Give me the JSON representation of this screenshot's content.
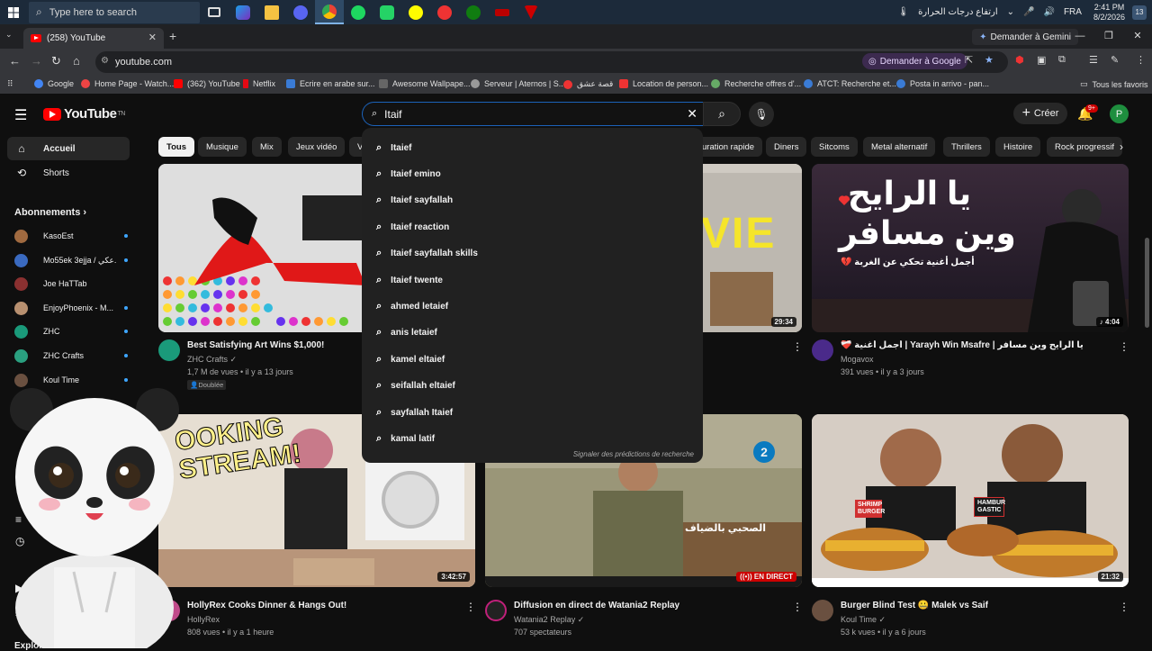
{
  "taskbar": {
    "search_placeholder": "Type here to search",
    "weather_text": "ارتفاع درجات الحرارة",
    "language": "FRA",
    "time": "2:41 PM",
    "date": "8/2/2026",
    "notifications": "13"
  },
  "browser": {
    "tab_title": "(258) YouTube",
    "gemini_label": "Demander à Gemini",
    "url": "youtube.com",
    "ask_google": "Demander à Google",
    "bookmarks": [
      "Google",
      "Home Page - Watch...",
      "(362) YouTube",
      "Netflix",
      "Ecrire en arabe sur...",
      "Awesome Wallpape...",
      "Serveur | Aternos | S...",
      "قصة عشق",
      "Location de person...",
      "Recherche offres d'...",
      "ATCT: Recherche et...",
      "Posta in arrivo - pan..."
    ],
    "all_bookmarks": "Tous les favoris",
    "colors": {
      "bookmark_icons": [
        "#4285f4",
        "#e44",
        "#ff0000",
        "#e50914",
        "#3a7bd5",
        "#666",
        "#999",
        "#e33",
        "#e33",
        "#6a6",
        "#3a7bd5",
        "#3a7bd5"
      ]
    }
  },
  "youtube": {
    "logo": "YouTube",
    "logo_tm": "TN",
    "search_value": "Itaif",
    "create_label": "Créer",
    "bell_badge": "9+",
    "avatar_letter": "P",
    "sidebar": {
      "items": [
        {
          "label": "Accueil",
          "icon": "home-icon"
        },
        {
          "label": "Shorts",
          "icon": "shorts-icon"
        }
      ],
      "subscriptions_title": "Abonnements",
      "subscriptions": [
        {
          "name": "KasoEst",
          "color": "#a06a40"
        },
        {
          "name": "Mo55ek 3ejja / عكي...",
          "color": "#3a6ac0"
        },
        {
          "name": "Joe HaTTab",
          "color": "#8a3030"
        },
        {
          "name": "EnjoyPhoenix - M...",
          "color": "#b89070"
        },
        {
          "name": "ZHC",
          "color": "#1a9a7a"
        },
        {
          "name": "ZHC Crafts",
          "color": "#2aa080"
        },
        {
          "name": "Koul Time",
          "color": "#6a5040"
        }
      ],
      "explorer": "Explorer"
    },
    "chips": [
      "Tous",
      "Musique",
      "Mix",
      "Jeux vidéo",
      "V",
      "uration rapide",
      "Diners",
      "Sitcoms",
      "Metal alternatif",
      "Thrillers",
      "Histoire",
      "Rock progressif"
    ],
    "suggestions": [
      "Itaief",
      "Itaief emino",
      "Itaief sayfallah",
      "Itaief reaction",
      "Itaief sayfallah skills",
      "Itaief twente",
      "ahmed letaief",
      "anis letaief",
      "kamel eltaief",
      "seifallah eltaief",
      "sayfallah Itaief",
      "kamal latif"
    ],
    "report_predictions": "Signaler des prédictions de recherche",
    "videos": [
      {
        "title": "Best Satisfying Art Wins $1,000!",
        "channel": "ZHC Crafts",
        "meta": "1,7 M de vues • il y a 13 jours",
        "badge": "Doublée"
      },
      {
        "title": "",
        "channel": "",
        "meta": "",
        "duration": "29:34",
        "thumb_text": "VIE"
      },
      {
        "title": "❤️‍🩹 أجمل أغنية | Yarayh Win Msafre | يا الرايح وين مسافر",
        "channel": "Mogavox",
        "meta": "391 vues • il y a 3 jours",
        "duration": "♪ 4:04",
        "thumb_text_1": "يا الرايح",
        "thumb_text_2": "وين مسافر",
        "thumb_sub": "أجمل أغنية تحكي عن الغربة 💔"
      },
      {
        "title": "HollyRex Cooks Dinner & Hangs Out!",
        "channel": "HollyRex",
        "meta": "808 vues • il y a 1 heure",
        "duration": "3:42:57",
        "thumb_text": "OOKING STREAM!"
      },
      {
        "title": "Diffusion en direct de Watania2 Replay",
        "channel": "Watania2 Replay",
        "meta": "707 spectateurs",
        "live": "EN DIRECT",
        "thumb_text": "الصحبي بالضياف"
      },
      {
        "title": "Burger Blind Test 🤐 Malek vs Saif",
        "channel": "Koul Time",
        "meta": "53 k vues • il y a 6 jours",
        "duration": "21:32",
        "thumb_text_1": "SHRIMP BURGER",
        "thumb_text_2": "HAMBUR GASTIC"
      }
    ]
  }
}
